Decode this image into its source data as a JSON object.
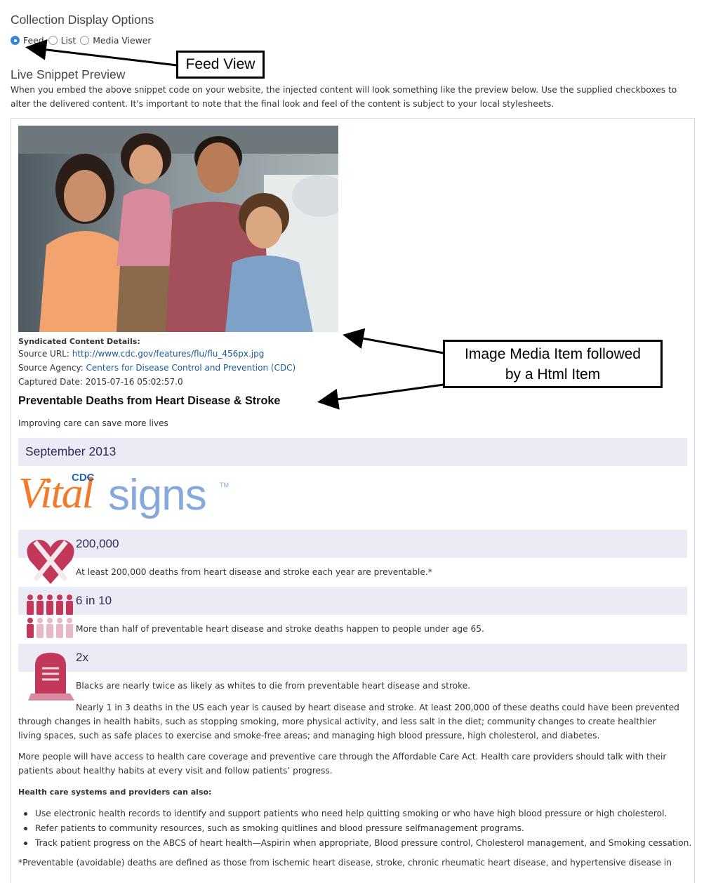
{
  "display_options": {
    "title": "Collection Display Options",
    "options": [
      {
        "label": "Feed",
        "selected": true
      },
      {
        "label": "List",
        "selected": false
      },
      {
        "label": "Media Viewer",
        "selected": false
      }
    ]
  },
  "preview": {
    "title": "Live Snippet Preview",
    "description": "When you embed the above snippet code on your website, the injected content will look something like the preview below. Use the supplied checkboxes to alter the delivered content. It's important to note that the final look and feel of the content is subject to your local stylesheets."
  },
  "media_item": {
    "details_label": "Syndicated Content Details:",
    "source_url_label": "Source URL:",
    "source_url": "http://www.cdc.gov/features/flu/flu_456px.jpg",
    "source_agency_label": "Source Agency:",
    "source_agency": "Centers for Disease Control and Prevention (CDC)",
    "captured_date_label": "Captured Date:",
    "captured_date": "2015-07-16 05:02:57.0"
  },
  "html_item": {
    "title": "Preventable Deaths from Heart Disease & Stroke",
    "subtitle": "Improving care can save more lives",
    "date": "September 2013",
    "logo": {
      "vital": "Vital",
      "signs": "signs",
      "cdc": "CDC",
      "tm": "TM"
    },
    "stats": [
      {
        "number": "200,000",
        "text": "At least 200,000 deaths from heart disease and stroke each year are preventable.*",
        "icon": "heart-x-icon"
      },
      {
        "number": "6 in 10",
        "text": "More than half of preventable heart disease and stroke deaths happen to people under age 65.",
        "icon": "people-icon"
      },
      {
        "number": "2x",
        "text": "Blacks are nearly twice as likely as whites to die from preventable heart disease and stroke.",
        "icon": "tombstone-icon"
      }
    ],
    "paragraph1": "Nearly 1 in 3 deaths in the US each year is caused by heart disease and stroke. At least 200,000 of these deaths could have been prevented through changes in health habits, such as stopping smoking, more physical activity, and less salt in the diet; community changes to create healthier living spaces, such as safe places to exercise and smoke-free areas; and managing high blood pressure, high cholesterol, and diabetes.",
    "paragraph2": "More people will have access to health care coverage and preventive care through the Affordable Care Act. Health care providers should talk with their patients about healthy habits at every visit and follow patients’ progress.",
    "list_heading": "Health care systems and providers can also:",
    "list": [
      "Use electronic health records to identify and support patients who need help quitting smoking or who have high blood pressure or high cholesterol.",
      "Refer patients to community resources, such as smoking quitlines and blood pressure selfmanagement programs.",
      "Track patient progress on the ABCS of heart health—Aspirin when appropriate, Blood pressure control, Cholesterol management, and Smoking cessation."
    ],
    "footnote": "*Preventable (avoidable) deaths are defined as those from ischemic heart disease, stroke, chronic rheumatic heart disease, and hypertensive disease in"
  },
  "annotations": {
    "feed_view": "Feed View",
    "media_item_line1": "Image Media Item followed",
    "media_item_line2": "by a Html Item"
  },
  "colors": {
    "accent_blue": "#3a86d6",
    "link": "#1a5b96",
    "band": "#ebebf5",
    "vital_orange": "#f07c2b",
    "signs_blue": "#86a8dc",
    "icon_red": "#c2385a"
  }
}
